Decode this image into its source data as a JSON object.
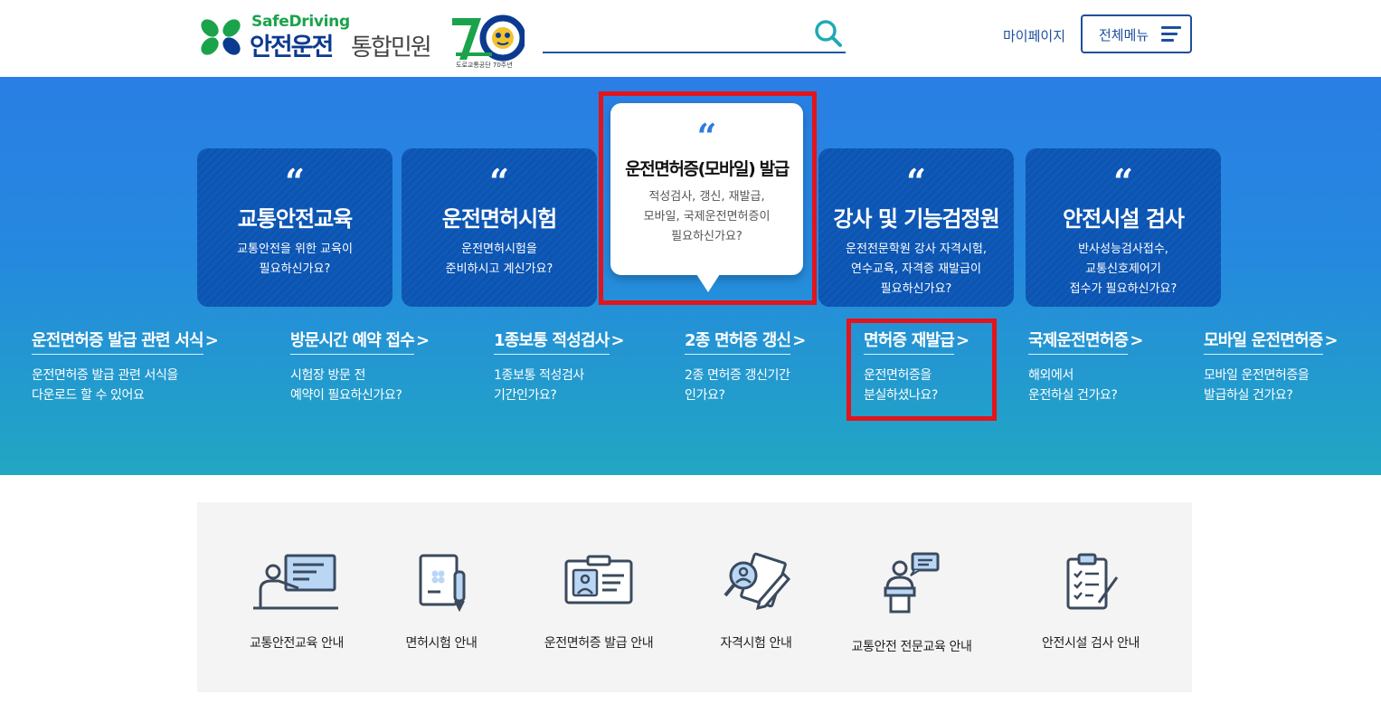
{
  "header": {
    "logo_brand": "SafeDriving",
    "logo_title": "안전운전",
    "logo_subtitle": "통합민원",
    "anniversary_caption": "도로교통공단 70주년",
    "search": {
      "placeholder": "",
      "value": ""
    },
    "mypage_label": "마이페이지",
    "allmenu_label": "전체메뉴"
  },
  "cards": [
    {
      "title": "교통안전교육",
      "desc": "교통안전을 위한 교육이\n필요하신가요?"
    },
    {
      "title": "운전면허시험",
      "desc": "운전면허시험을\n준비하시고 계신가요?"
    },
    {
      "title": "운전면허증(모바일) 발급",
      "desc": "적성검사, 갱신, 재발급,\n모바일, 국제운전면허증이\n필요하신가요?",
      "active": true
    },
    {
      "title": "강사 및 기능검정원",
      "desc": "운전전문학원 강사 자격시험,\n연수교육, 자격증 재발급이\n필요하신가요?"
    },
    {
      "title": "안전시설 검사",
      "desc": "반사성능검사접수,\n교통신호제어기\n접수가 필요하신가요?"
    }
  ],
  "quick_links": [
    {
      "title": "운전면허증 발급 관련 서식",
      "arrow": ">",
      "desc": "운전면허증 발급 관련 서식을\n다운로드 할 수 있어요"
    },
    {
      "title": "방문시간 예약 접수",
      "arrow": ">",
      "desc": "시험장 방문 전\n예약이 필요하신가요?"
    },
    {
      "title": "1종보통 적성검사",
      "arrow": ">",
      "desc": "1종보통 적성검사\n기간인가요?"
    },
    {
      "title": "2종 면허증 갱신",
      "arrow": ">",
      "desc": "2종 면허증 갱신기간\n인가요?"
    },
    {
      "title": "면허증 재발급",
      "arrow": ">",
      "desc": "운전면허증을\n분실하셨나요?",
      "highlighted": true
    },
    {
      "title": "국제운전면허증",
      "arrow": ">",
      "desc": "해외에서\n운전하실 건가요?"
    },
    {
      "title": "모바일 운전면허증",
      "arrow": ">",
      "desc": "모바일 운전면허증을\n발급하실 건가요?"
    }
  ],
  "guides": [
    {
      "label": "교통안전교육 안내",
      "icon": "lecture-icon"
    },
    {
      "label": "면허시험 안내",
      "icon": "license-exam-icon"
    },
    {
      "label": "운전면허증 발급 안내",
      "icon": "id-card-icon"
    },
    {
      "label": "자격시험 안내",
      "icon": "qualification-exam-icon"
    },
    {
      "label": "교통안전 전문교육 안내",
      "icon": "speaker-podium-icon"
    },
    {
      "label": "안전시설 검사 안내",
      "icon": "checklist-clipboard-icon"
    }
  ],
  "colors": {
    "hero_top": "#2a7ee4",
    "hero_bottom": "#21a7c2",
    "card_bg": "#0f5ab8",
    "highlight": "#e3141b",
    "brand_navy": "#1e4f9c",
    "brand_green": "#1aa34a"
  }
}
